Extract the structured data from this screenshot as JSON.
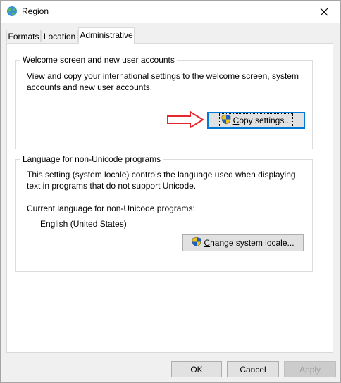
{
  "window": {
    "title": "Region",
    "close_glyph": "✕"
  },
  "tabs": [
    {
      "label": "Formats"
    },
    {
      "label": "Location"
    },
    {
      "label": "Administrative"
    }
  ],
  "welcome_group": {
    "title": "Welcome screen and new user accounts",
    "line1": "View and copy your international settings to the welcome screen, system",
    "line2": "accounts and new user accounts.",
    "button_underlined": "C",
    "button_rest": "opy settings..."
  },
  "locale_group": {
    "title": "Language for non-Unicode programs",
    "line1": "This setting (system locale) controls the language used when displaying",
    "line2": "text in programs that do not support Unicode.",
    "current_label": "Current language for non-Unicode programs:",
    "current_value": "English (United States)",
    "button_underlined": "C",
    "button_rest": "hange system locale..."
  },
  "footer": {
    "ok_label": "OK",
    "cancel_label": "Cancel",
    "apply_label": "Apply"
  },
  "colors": {
    "focus_border": "#0078d7",
    "arrow_red": "#e8262d"
  }
}
